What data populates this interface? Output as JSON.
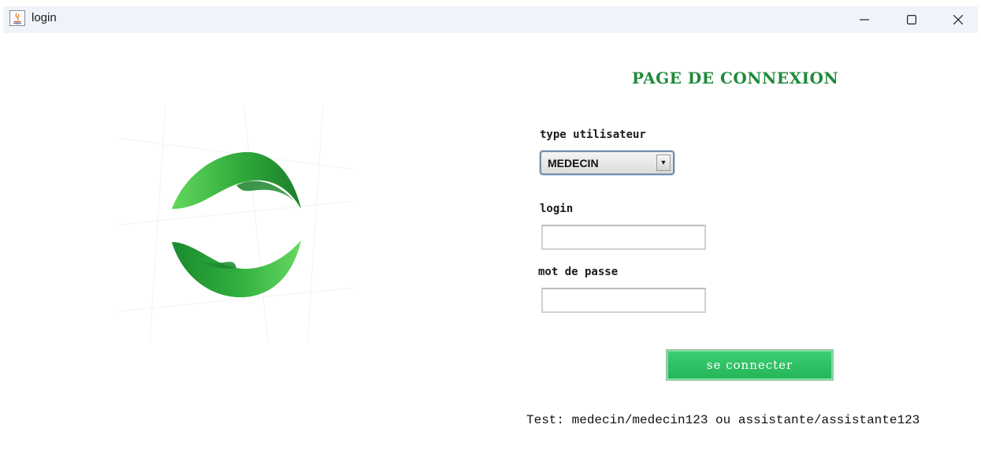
{
  "window": {
    "title": "login",
    "controls": {
      "minimize_icon": "minimize-icon",
      "maximize_icon": "maximize-icon",
      "close_icon": "close-icon"
    }
  },
  "logo": {
    "icon": "green-wave-logo",
    "colors": {
      "light": "#5fd55f",
      "dark": "#1e8a2e"
    }
  },
  "form": {
    "title": "PAGE DE CONNEXION",
    "user_type": {
      "label": "type utilisateur",
      "selected": "MEDECIN"
    },
    "login": {
      "label": "login",
      "value": ""
    },
    "password": {
      "label": "mot de passe",
      "value": ""
    },
    "submit_label": "se connecter",
    "hint": "Test: medecin/medecin123 ou assistante/assistante123"
  },
  "colors": {
    "accent": "#1f8a3a",
    "button": "#2cc065",
    "titlebar": "#eef4f9"
  }
}
